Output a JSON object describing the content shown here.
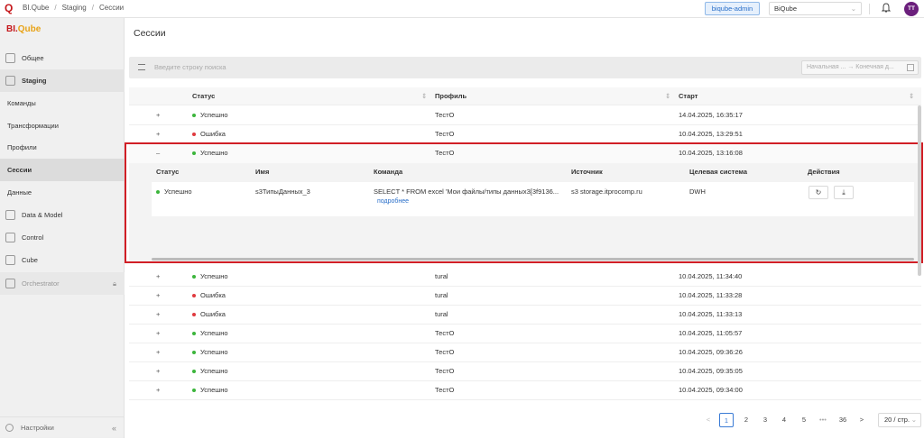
{
  "breadcrumb": {
    "app": "BI.Qube",
    "section": "Staging",
    "page": "Сессии"
  },
  "header": {
    "user_badge": "biqube-admin",
    "project": "BiQube",
    "avatar": "TT"
  },
  "sidebar": {
    "brand_main": "BI.",
    "brand_accent": "Qube",
    "items": [
      {
        "label": "Общее"
      },
      {
        "label": "Staging"
      },
      {
        "label": "Команды"
      },
      {
        "label": "Трансформации"
      },
      {
        "label": "Профили"
      },
      {
        "label": "Сессии"
      },
      {
        "label": "Данные"
      },
      {
        "label": "Data & Model"
      },
      {
        "label": "Control"
      },
      {
        "label": "Cube"
      },
      {
        "label": "Orchestrator"
      }
    ],
    "settings": "Настройки"
  },
  "page_title": "Сессии",
  "search": {
    "placeholder": "Введите строку поиска",
    "date_range": "Начальная ... → Конечная д..."
  },
  "table": {
    "columns": {
      "status": "Статус",
      "profile": "Профиль",
      "start": "Старт"
    },
    "rows": [
      {
        "status": "Успешно",
        "state": "ok",
        "profile": "ТестО",
        "start": "14.04.2025, 16:35:17",
        "expand": "+"
      },
      {
        "status": "Ошибка",
        "state": "err",
        "profile": "ТестО",
        "start": "10.04.2025, 13:29:51",
        "expand": "+"
      },
      {
        "status": "Успешно",
        "state": "ok",
        "profile": "ТестО",
        "start": "10.04.2025, 13:16:08",
        "expand": "–"
      },
      {
        "status": "Успешно",
        "state": "ok",
        "profile": "tural",
        "start": "10.04.2025, 11:34:40",
        "expand": "+"
      },
      {
        "status": "Ошибка",
        "state": "err",
        "profile": "tural",
        "start": "10.04.2025, 11:33:28",
        "expand": "+"
      },
      {
        "status": "Ошибка",
        "state": "err",
        "profile": "tural",
        "start": "10.04.2025, 11:33:13",
        "expand": "+"
      },
      {
        "status": "Успешно",
        "state": "ok",
        "profile": "ТестО",
        "start": "10.04.2025, 11:05:57",
        "expand": "+"
      },
      {
        "status": "Успешно",
        "state": "ok",
        "profile": "ТестО",
        "start": "10.04.2025, 09:36:26",
        "expand": "+"
      },
      {
        "status": "Успешно",
        "state": "ok",
        "profile": "ТестО",
        "start": "10.04.2025, 09:35:05",
        "expand": "+"
      },
      {
        "status": "Успешно",
        "state": "ok",
        "profile": "ТестО",
        "start": "10.04.2025, 09:34:00",
        "expand": "+"
      }
    ]
  },
  "detail": {
    "columns": {
      "status": "Статус",
      "name": "Имя",
      "command": "Команда",
      "source": "Источник",
      "target": "Целевая система",
      "actions": "Действия"
    },
    "row": {
      "status": "Успешно",
      "name": "s3ТипыДанных_3",
      "command": "SELECT * FROM excel 'Мои файлы/типы данных3[3f9136...",
      "more": "подробнее",
      "source": "s3 storage.itprocomp.ru",
      "target": "DWH"
    },
    "actions": {
      "refresh": "↻",
      "download": "⤓"
    }
  },
  "pagination": {
    "prev": "<",
    "pages": [
      "1",
      "2",
      "3",
      "4",
      "5"
    ],
    "ellipsis": "•••",
    "last": "36",
    "next": ">",
    "page_size": "20 / стр."
  }
}
